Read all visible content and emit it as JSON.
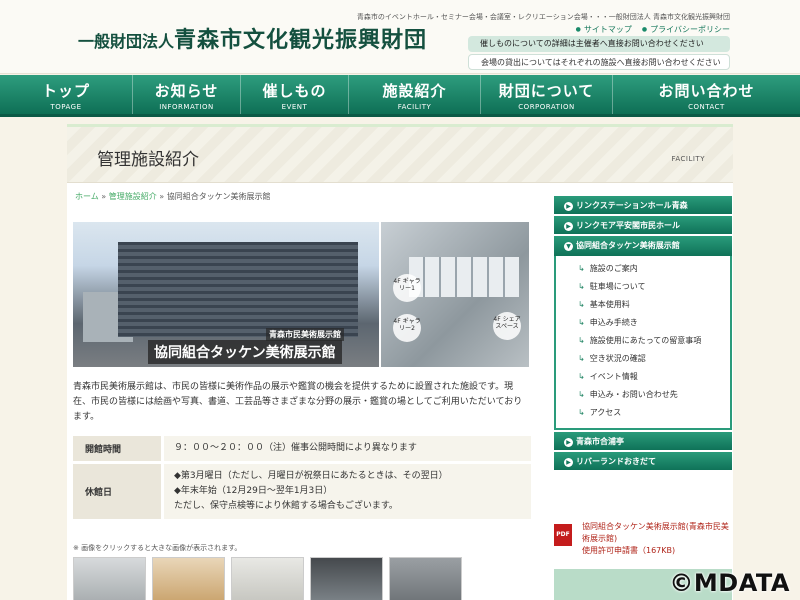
{
  "header": {
    "logo_small": "一般財団法人",
    "logo_main": "青森市文化観光振興財団",
    "tagline": "青森市のイベントホール・セミナー会場・会議室・レクリエーション会場・・・一般財団法人 青森市文化観光振興財団",
    "links": [
      "サイトマップ",
      "プライバシーポリシー"
    ],
    "notice1": "催しものについての詳細は主催者へ直接お問い合わせください",
    "notice2": "会場の貸出についてはそれぞれの施設へ直接お問い合わせください"
  },
  "nav": [
    {
      "jp": "トップ",
      "en": "TOPAGE"
    },
    {
      "jp": "お知らせ",
      "en": "INFORMATION"
    },
    {
      "jp": "催しもの",
      "en": "EVENT"
    },
    {
      "jp": "施設紹介",
      "en": "FACILITY"
    },
    {
      "jp": "財団について",
      "en": "CORPORATION"
    },
    {
      "jp": "お問い合わせ",
      "en": "CONTACT"
    }
  ],
  "page": {
    "title": "管理施設紹介",
    "title_en": "FACILITY",
    "breadcrumb": [
      "ホーム",
      "管理施設紹介",
      "協同組合タッケン美術展示館"
    ]
  },
  "main_image": {
    "sign_main": "協同組合タッケン美術展示館",
    "sign_sub": "青森市民美術展示館",
    "floor_signs": [
      "4F ギャラリー1",
      "4F ギャラリー2",
      "4F シェアスペース"
    ]
  },
  "intro": "青森市民美術展示館は、市民の皆様に美術作品の展示や鑑賞の機会を提供するために設置された施設です。現在、市民の皆様には絵画や写真、書道、工芸品等さまざまな分野の展示・鑑賞の場としてご利用いただいております。",
  "info": {
    "hours_label": "開館時間",
    "hours_value": "９：００〜２０：００（注）催事公開時間により異なります",
    "closed_label": "休館日",
    "closed_lines": [
      "◆第3月曜日（ただし、月曜日が祝祭日にあたるときは、その翌日）",
      "◆年末年始（12月29日〜翌年1月3日）",
      "ただし、保守点検等により休館する場合もございます。"
    ]
  },
  "thumbnote": "※ 画像をクリックすると大きな画像が表示されます。",
  "sidebar": {
    "item1": "リンクステーションホール青森",
    "item2": "リンクモア平安閣市民ホール",
    "item3": "協同組合タッケン美術展示館",
    "sub": [
      "施設のご案内",
      "駐車場について",
      "基本使用料",
      "申込み手続き",
      "施設使用にあたっての留意事項",
      "空き状況の確認",
      "イベント情報",
      "申込み・お問い合わせ先",
      "アクセス"
    ],
    "item4": "青森市合浦亭",
    "item5": "リバーランドおきだて"
  },
  "pdf": {
    "icon": "PDF",
    "link": "協同組合タッケン美術展示館(青森市民美術展示館)",
    "line2": "使用許可申請書（167KB)"
  },
  "watermark": "©MDATA",
  "colors": {
    "accent": "#1a8a6a",
    "nav_dark": "#0e6f55",
    "pdf_red": "#b0251a"
  }
}
